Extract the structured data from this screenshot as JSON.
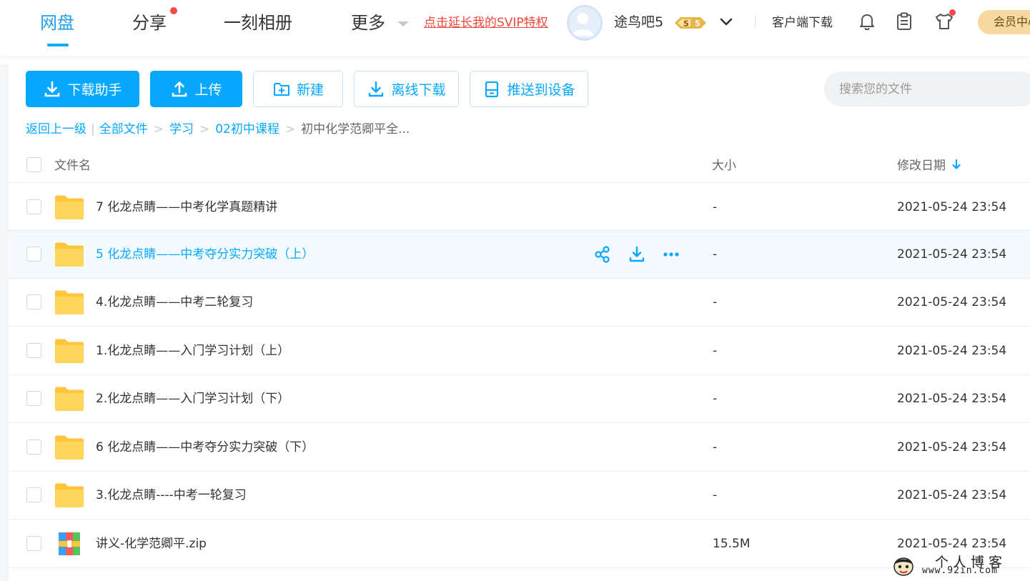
{
  "nav": {
    "items": [
      {
        "label": "网盘",
        "active": true
      },
      {
        "label": "分享",
        "dot": true
      },
      {
        "label": "一刻相册"
      },
      {
        "label": "更多"
      }
    ],
    "svip_promo": "点击延长我的SVIP特权",
    "username": "途鸟吧5",
    "svip_level": "5",
    "client_download": "客户端下载",
    "vip_center": "会员中心",
    "icons": [
      "bell-icon",
      "clipboard-icon",
      "tshirt-icon"
    ]
  },
  "toolbar": {
    "download_helper": "下载助手",
    "upload": "上传",
    "new": "新建",
    "offline_download": "离线下载",
    "push_to_device": "推送到设备",
    "search_placeholder": "搜索您的文件"
  },
  "breadcrumb": {
    "back": "返回上一级",
    "items": [
      "全部文件",
      "学习",
      "02初中课程"
    ],
    "current": "初中化学范卿平全..."
  },
  "table": {
    "columns": {
      "name": "文件名",
      "size": "大小",
      "date": "修改日期"
    },
    "rows": [
      {
        "name": "7 化龙点睛——中考化学真题精讲",
        "size": "-",
        "date": "2021-05-24 23:54",
        "type": "folder"
      },
      {
        "name": "5 化龙点睛——中考夺分实力突破（上）",
        "size": "-",
        "date": "2021-05-24 23:54",
        "type": "folder",
        "hover": true
      },
      {
        "name": "4.化龙点睛——中考二轮复习",
        "size": "-",
        "date": "2021-05-24 23:54",
        "type": "folder"
      },
      {
        "name": "1.化龙点睛——入门学习计划（上）",
        "size": "-",
        "date": "2021-05-24 23:54",
        "type": "folder"
      },
      {
        "name": "2.化龙点睛——入门学习计划（下）",
        "size": "-",
        "date": "2021-05-24 23:54",
        "type": "folder"
      },
      {
        "name": "6 化龙点睛——中考夺分实力突破（下）",
        "size": "-",
        "date": "2021-05-24 23:54",
        "type": "folder"
      },
      {
        "name": "3.化龙点睛----中考一轮复习",
        "size": "-",
        "date": "2021-05-24 23:54",
        "type": "folder"
      },
      {
        "name": "讲义-化学范卿平.zip",
        "size": "15.5M",
        "date": "2021-05-24 23:54",
        "type": "zip"
      }
    ]
  },
  "watermark": {
    "title": "个人博客",
    "url": "www.92in.com"
  },
  "colors": {
    "accent": "#06a7ff",
    "promo_red": "#f0463c",
    "folder_yellow": "#ffd659",
    "hover_bg": "#f4fbff"
  }
}
